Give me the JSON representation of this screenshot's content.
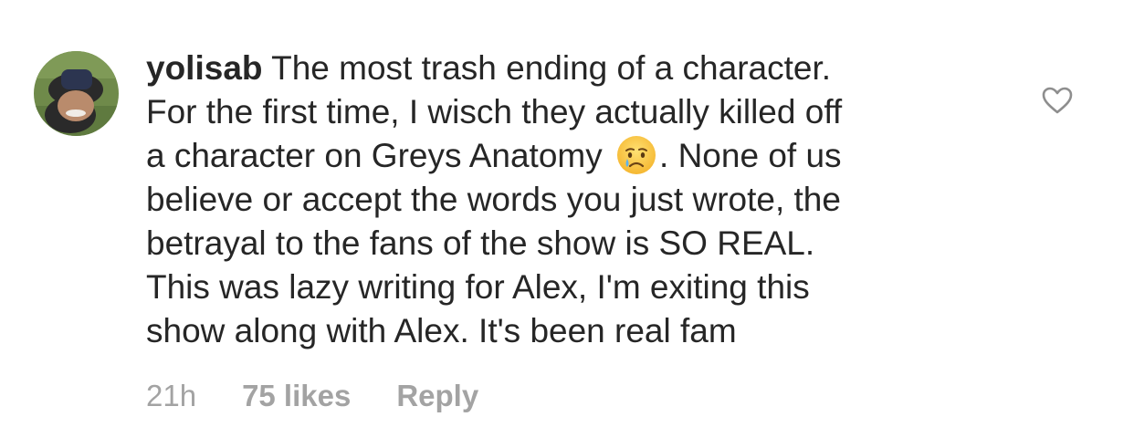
{
  "comment": {
    "username": "yolisab",
    "lines": [
      "The most trash ending  of a character.",
      "For the first time, I wisch they actually killed off",
      "a character on Greys Anatomy",
      ". None of us",
      "believe or accept the words you just wrote, the",
      "betrayal to the fans of the show is SO REAL.",
      "This was lazy writing for Alex,  I'm exiting this",
      "show along with Alex.  It's been real fam"
    ],
    "emoji": "crying-face-emoji",
    "time": "21h",
    "likes": "75 likes",
    "reply_label": "Reply",
    "like_icon": "heart-outline-icon"
  },
  "colors": {
    "text": "#262626",
    "meta": "#a3a3a3",
    "icon": "#8e8e8e"
  }
}
